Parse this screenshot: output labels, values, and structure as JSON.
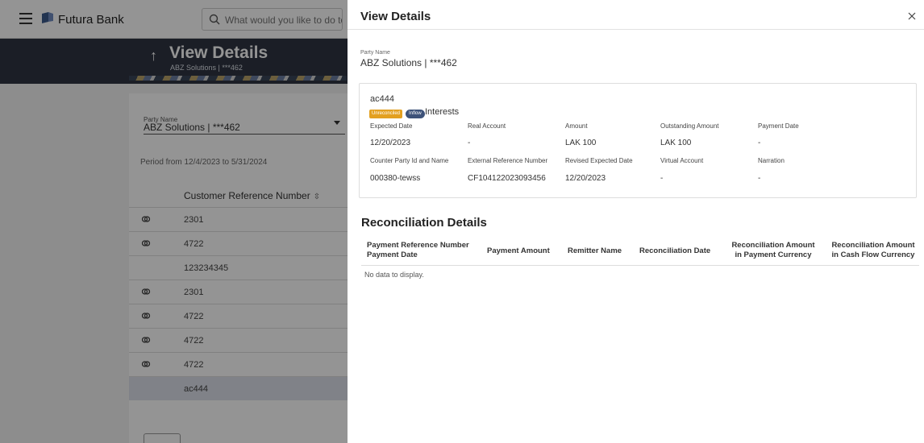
{
  "app": {
    "brand": "Futura Bank",
    "search_placeholder": "What would you like to do today?",
    "page_title": "View Details",
    "page_subtitle": "ABZ Solutions | ***462"
  },
  "background": {
    "party_label": "Party Name",
    "party_value": "ABZ Solutions | ***462",
    "period": "Period from 12/4/2023 to 5/31/2024",
    "column_header": "Customer Reference Number",
    "sort_glyph": "⇳",
    "rows": [
      {
        "ref": "2301",
        "has_icon": true
      },
      {
        "ref": "4722",
        "has_icon": true
      },
      {
        "ref": "123234345",
        "has_icon": false
      },
      {
        "ref": "2301",
        "has_icon": true
      },
      {
        "ref": "4722",
        "has_icon": true
      },
      {
        "ref": "4722",
        "has_icon": true
      },
      {
        "ref": "4722",
        "has_icon": true
      },
      {
        "ref": "ac444",
        "has_icon": false,
        "selected": true
      }
    ]
  },
  "modal": {
    "title": "View Details",
    "close_glyph": "×",
    "party_label": "Party Name",
    "party_value": "ABZ Solutions | ***462",
    "detail": {
      "id": "ac444",
      "status_badge": "Unreconciled",
      "flow_badge": "Inflow",
      "category": "Interests",
      "fields": [
        {
          "label": "Expected Date",
          "value": "12/20/2023"
        },
        {
          "label": "Real Account",
          "value": "-"
        },
        {
          "label": "Amount",
          "value": "LAK 100"
        },
        {
          "label": "Outstanding Amount",
          "value": "LAK 100"
        },
        {
          "label": "Payment Date",
          "value": "-"
        },
        {
          "label": "Counter Party Id and Name",
          "value": "000380-tewss"
        },
        {
          "label": "External Reference Number",
          "value": "CF104122023093456"
        },
        {
          "label": "Revised Expected Date",
          "value": "12/20/2023"
        },
        {
          "label": "Virtual Account",
          "value": "-"
        },
        {
          "label": "Narration",
          "value": "-"
        }
      ]
    },
    "reconciliation": {
      "title": "Reconciliation Details",
      "columns": [
        {
          "line1": "Payment Reference Number",
          "line2": "Payment Date"
        },
        {
          "line1": "Payment Amount",
          "line2": ""
        },
        {
          "line1": "Remitter Name",
          "line2": ""
        },
        {
          "line1": "Reconciliation Date",
          "line2": ""
        },
        {
          "line1": "Reconciliation Amount",
          "line2": "in Payment Currency"
        },
        {
          "line1": "Reconciliation Amount",
          "line2": "in Cash Flow Currency"
        }
      ],
      "empty_text": "No data to display."
    }
  },
  "colors": {
    "unreconciled_badge": "#e3a020",
    "inflow_badge": "#3d5279",
    "hero_bg": "#2f3542"
  }
}
